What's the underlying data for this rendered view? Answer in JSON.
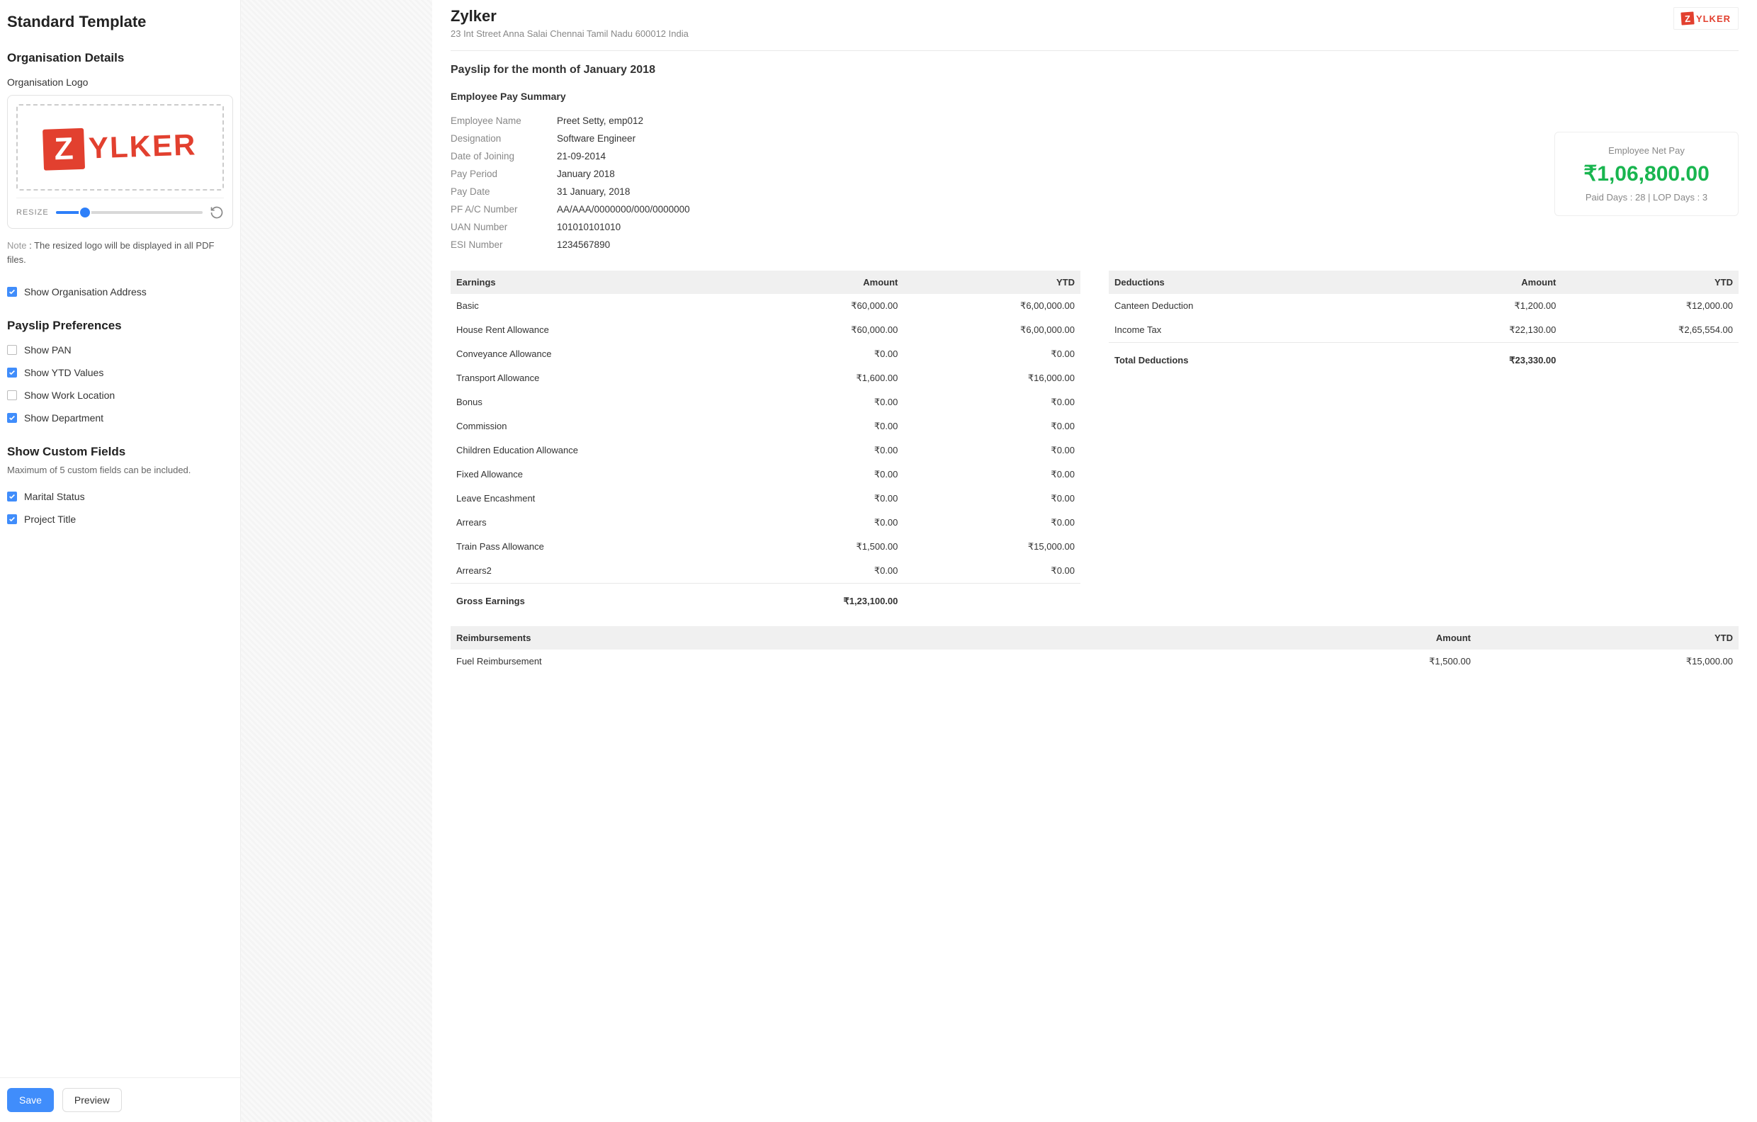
{
  "sidebar": {
    "title": "Standard Template",
    "org_section_title": "Organisation Details",
    "logo_label": "Organisation Logo",
    "zylker_z": "Z",
    "zylker_text": "YLKER",
    "resize_label": "RESIZE",
    "note_prefix": "Note",
    "note_text": " : The resized logo will be displayed in all PDF files.",
    "show_org_address": "Show Organisation Address",
    "prefs_title": "Payslip Preferences",
    "prefs": {
      "pan": "Show PAN",
      "ytd": "Show YTD Values",
      "workloc": "Show Work Location",
      "dept": "Show Department"
    },
    "custom_title": "Show Custom Fields",
    "custom_hint": "Maximum of 5 custom fields can be included.",
    "custom_fields": {
      "marital": "Marital Status",
      "project": "Project Title"
    },
    "save_label": "Save",
    "preview_label": "Preview"
  },
  "preview": {
    "org_name": "Zylker",
    "org_address": "23 Int Street Anna Salai Chennai Tamil Nadu 600012 India",
    "payslip_title": "Payslip for the month of January 2018",
    "summary_title": "Employee Pay Summary",
    "summary": [
      {
        "key": "Employee Name",
        "val": "Preet Setty, emp012"
      },
      {
        "key": "Designation",
        "val": "Software Engineer"
      },
      {
        "key": "Date of Joining",
        "val": "21-09-2014"
      },
      {
        "key": "Pay Period",
        "val": "January 2018"
      },
      {
        "key": "Pay Date",
        "val": "31 January, 2018"
      },
      {
        "key": "PF A/C Number",
        "val": "AA/AAA/0000000/000/0000000"
      },
      {
        "key": "UAN Number",
        "val": "101010101010"
      },
      {
        "key": "ESI Number",
        "val": "1234567890"
      }
    ],
    "netpay_label": "Employee Net Pay",
    "netpay_amount": "₹1,06,800.00",
    "netpay_days": "Paid Days : 28 | LOP Days : 3",
    "earnings_header": "Earnings",
    "amount_header": "Amount",
    "ytd_header": "YTD",
    "deductions_header": "Deductions",
    "earnings": [
      {
        "name": "Basic",
        "amount": "₹60,000.00",
        "ytd": "₹6,00,000.00"
      },
      {
        "name": "House Rent Allowance",
        "amount": "₹60,000.00",
        "ytd": "₹6,00,000.00"
      },
      {
        "name": "Conveyance Allowance",
        "amount": "₹0.00",
        "ytd": "₹0.00"
      },
      {
        "name": "Transport Allowance",
        "amount": "₹1,600.00",
        "ytd": "₹16,000.00"
      },
      {
        "name": "Bonus",
        "amount": "₹0.00",
        "ytd": "₹0.00"
      },
      {
        "name": "Commission",
        "amount": "₹0.00",
        "ytd": "₹0.00"
      },
      {
        "name": "Children Education Allowance",
        "amount": "₹0.00",
        "ytd": "₹0.00"
      },
      {
        "name": "Fixed Allowance",
        "amount": "₹0.00",
        "ytd": "₹0.00"
      },
      {
        "name": "Leave Encashment",
        "amount": "₹0.00",
        "ytd": "₹0.00"
      },
      {
        "name": "Arrears",
        "amount": "₹0.00",
        "ytd": "₹0.00"
      },
      {
        "name": "Train Pass Allowance",
        "amount": "₹1,500.00",
        "ytd": "₹15,000.00"
      },
      {
        "name": "Arrears2",
        "amount": "₹0.00",
        "ytd": "₹0.00"
      }
    ],
    "gross_earnings_label": "Gross Earnings",
    "gross_earnings_amount": "₹1,23,100.00",
    "deductions": [
      {
        "name": "Canteen Deduction",
        "amount": "₹1,200.00",
        "ytd": "₹12,000.00"
      },
      {
        "name": "Income Tax",
        "amount": "₹22,130.00",
        "ytd": "₹2,65,554.00"
      }
    ],
    "total_deductions_label": "Total Deductions",
    "total_deductions_amount": "₹23,330.00",
    "reimb_header": "Reimbursements",
    "reimb": [
      {
        "name": "Fuel Reimbursement",
        "amount": "₹1,500.00",
        "ytd": "₹15,000.00"
      }
    ]
  }
}
